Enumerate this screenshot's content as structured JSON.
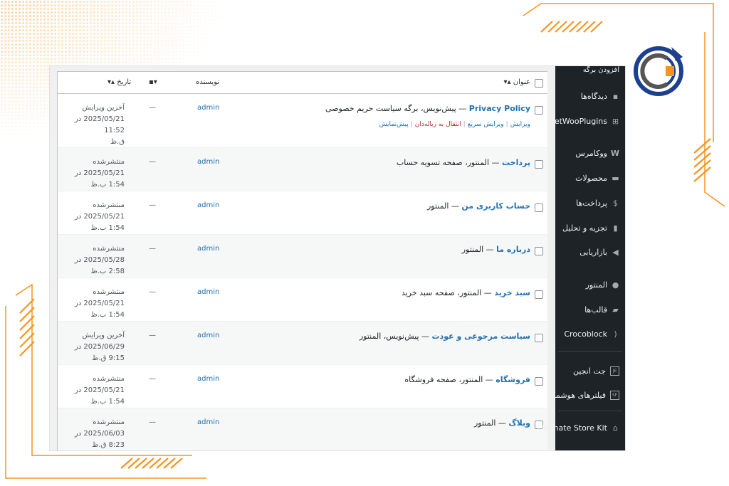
{
  "table": {
    "headers": {
      "title": "عنوان",
      "author": "نویسنده",
      "comments": "",
      "date": "تاریخ"
    },
    "rows": [
      {
        "title_link": "Privacy Policy",
        "title_rest": " — پیش‌نویس، برگه سیاست حریم خصوصی",
        "actions": [
          "ویرایش",
          "ویرایش سریع",
          "انتقال به زباله‌دان",
          "پیش‌نمایش"
        ],
        "author": "admin",
        "comments": "—",
        "date_status": "آخرین ویرایش",
        "date_line2": "2025/05/21 در 11:52",
        "date_line3": "ق.ظ"
      },
      {
        "title_link": "پرداخت",
        "title_rest": " — المنتور، صفحه تسویه حساب",
        "author": "admin",
        "comments": "—",
        "date_status": "منتشرشده",
        "date_line2": "2025/05/21 در 1:54 ب.ظ"
      },
      {
        "title_link": "حساب کاربری من",
        "title_rest": " — المنتور",
        "author": "admin",
        "comments": "—",
        "date_status": "منتشرشده",
        "date_line2": "2025/05/21 در 1:54 ب.ظ"
      },
      {
        "title_link": "درباره ما",
        "title_rest": " — المنتور",
        "author": "admin",
        "comments": "—",
        "date_status": "منتشرشده",
        "date_line2": "2025/05/28 در 2:58 ب.ظ"
      },
      {
        "title_link": "سبد خرید",
        "title_rest": " — المنتور، صفحه سبد خرید",
        "author": "admin",
        "comments": "—",
        "date_status": "منتشرشده",
        "date_line2": "2025/05/21 در 1:54 ب.ظ"
      },
      {
        "title_link": "سیاست مرجوعی و عودت",
        "title_rest": " — پیش‌نویس، المنتور",
        "author": "admin",
        "comments": "—",
        "date_status": "آخرین ویرایش",
        "date_line2": "2025/06/29 در 9:15 ق.ظ"
      },
      {
        "title_link": "فروشگاه",
        "title_rest": " — المنتور، صفحه فروشگاه",
        "author": "admin",
        "comments": "—",
        "date_status": "منتشرشده",
        "date_line2": "2025/05/21 در 1:54 ب.ظ"
      },
      {
        "title_link": "وبلاگ",
        "title_rest": " — المنتور",
        "author": "admin",
        "comments": "—",
        "date_status": "منتشرشده",
        "date_line2": "2025/06/03 در 8:23 ق.ظ"
      }
    ]
  },
  "sidebar": {
    "top_item": "افزودن برگه",
    "items": [
      {
        "label": "دیدگاه‌ها",
        "icon": "comment-icon"
      },
      {
        "label": "GetWooPlugins",
        "icon": "plus-box-icon"
      },
      {
        "label": "ووکامرس",
        "icon": "woo-icon"
      },
      {
        "label": "محصولات",
        "icon": "archive-icon"
      },
      {
        "label": "پرداخت‌ها",
        "icon": "dollar-icon"
      },
      {
        "label": "تجزیه و تحلیل",
        "icon": "bar-chart-icon"
      },
      {
        "label": "بازاریابی",
        "icon": "megaphone-icon"
      },
      {
        "label": "المنتور",
        "icon": "elementor-icon"
      },
      {
        "label": "قالب‌ها",
        "icon": "folder-icon"
      },
      {
        "label": "Crocoblock",
        "icon": "crocoblock-icon"
      },
      {
        "label": "جت انجین",
        "icon": "jet-engine-icon"
      },
      {
        "label": "فیلترهای هوشمند",
        "icon": "jet-filter-icon"
      },
      {
        "label": "Ultimate Store Kit",
        "icon": "bag-icon"
      }
    ]
  },
  "colors": {
    "accent": "#f7941d",
    "sidebar_bg": "#1d2327",
    "link": "#2271b1"
  }
}
